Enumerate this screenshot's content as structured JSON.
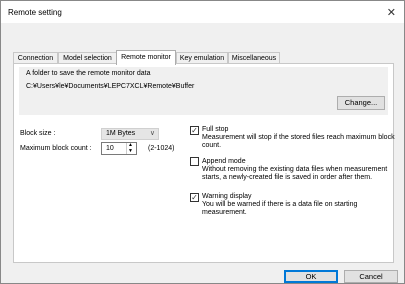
{
  "window": {
    "title": "Remote setting",
    "close_glyph": "✕"
  },
  "tabs": [
    {
      "label": "Connection"
    },
    {
      "label": "Model selection"
    },
    {
      "label": "Remote monitor"
    },
    {
      "label": "Key emulation"
    },
    {
      "label": "Miscellaneous"
    }
  ],
  "folder": {
    "label": "A folder to save the remote monitor data",
    "path": "C:¥Users¥le¥Documents¥LEPC7XCL¥Remote¥Buffer",
    "change_button": "Change..."
  },
  "block_size": {
    "label": "Block size :",
    "value": "1M Bytes"
  },
  "max_block": {
    "label": "Maximum block count :",
    "value": "10",
    "range": "(2-1024)"
  },
  "options": {
    "full_stop": {
      "label": "Full stop",
      "checked": true,
      "desc": "Measurement will stop if the stored files reach maximum block count."
    },
    "append": {
      "label": "Append mode",
      "checked": false,
      "desc": "Without removing the existing data files when measurement starts, a newly-created file is saved in order after them."
    },
    "warning": {
      "label": "Warning display",
      "checked": true,
      "desc": "You will be warned if there is a data file on starting measurement."
    }
  },
  "buttons": {
    "ok": "OK",
    "cancel": "Cancel"
  },
  "icons": {
    "close": "close-icon",
    "dropdown": "chevron-down-icon",
    "check": "checkmark-icon"
  }
}
